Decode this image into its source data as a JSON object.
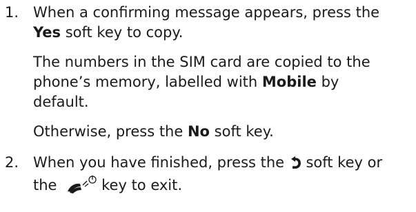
{
  "steps": [
    {
      "number": "1.",
      "line1_prefix": "When a confirming message appears, press the",
      "yes_key": "Yes",
      "line2_suffix": " soft key to copy.",
      "para2_line1": "The numbers in the SIM card are copied to the",
      "para2_line2_prefix": "phone’s memory, labelled with ",
      "mobile_label": "Mobile",
      "para2_line2_suffix": " by",
      "para2_line3": "default.",
      "para3_prefix": "Otherwise, press the ",
      "no_key": "No",
      "para3_suffix": " soft key."
    },
    {
      "number": "2.",
      "line1_prefix": "When you have finished, press the ",
      "back_icon": "back-arrow-icon",
      "line1_suffix": " soft key or",
      "line2_prefix": "the ",
      "end_icon": "end-power-key-icon",
      "line2_suffix": "key to exit."
    }
  ]
}
